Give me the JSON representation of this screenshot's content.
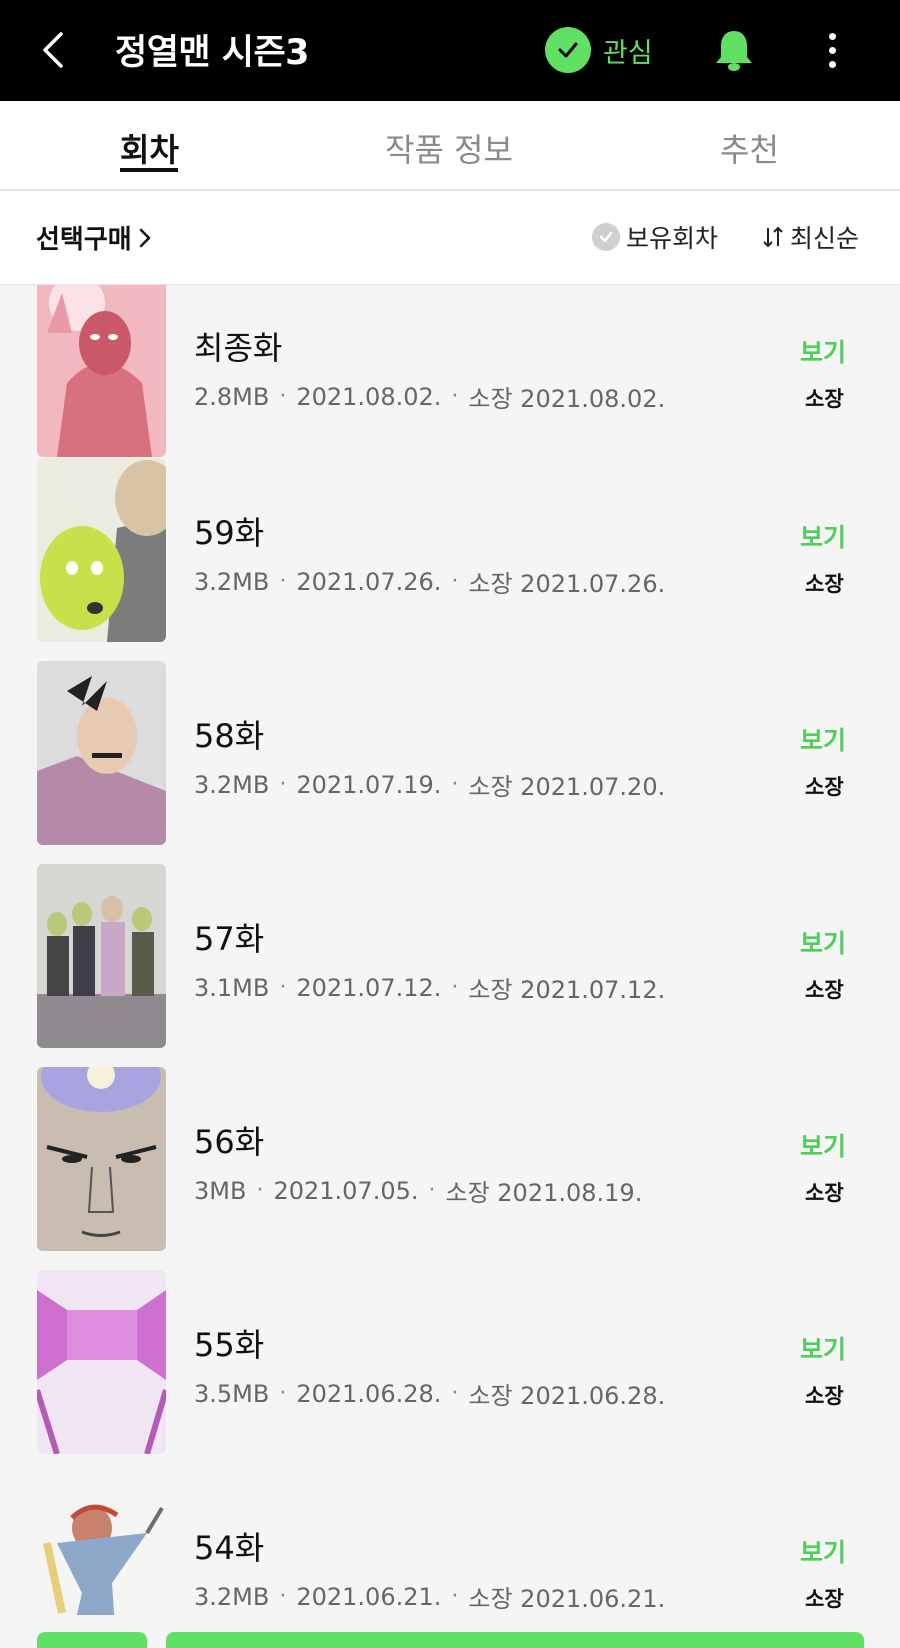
{
  "header": {
    "title": "정열맨 시즌3",
    "favorite_label": "관심",
    "icons": [
      "back-icon",
      "check-icon",
      "bell-icon",
      "more-vertical-icon"
    ],
    "accent_color": "#5fe063"
  },
  "tabs": [
    {
      "label": "회차",
      "active": true
    },
    {
      "label": "작품 정보",
      "active": false
    },
    {
      "label": "추천",
      "active": false
    }
  ],
  "filter": {
    "select_buy": "선택구매",
    "owned_label": "보유회차",
    "sort_label": "최신순"
  },
  "episodes": [
    {
      "title": "최종화",
      "size": "2.8MB",
      "date": "2021.08.02.",
      "owned": "소장 2021.08.02.",
      "view": "보기",
      "badge": "소장"
    },
    {
      "title": "59화",
      "size": "3.2MB",
      "date": "2021.07.26.",
      "owned": "소장 2021.07.26.",
      "view": "보기",
      "badge": "소장"
    },
    {
      "title": "58화",
      "size": "3.2MB",
      "date": "2021.07.19.",
      "owned": "소장 2021.07.20.",
      "view": "보기",
      "badge": "소장"
    },
    {
      "title": "57화",
      "size": "3.1MB",
      "date": "2021.07.12.",
      "owned": "소장 2021.07.12.",
      "view": "보기",
      "badge": "소장"
    },
    {
      "title": "56화",
      "size": "3MB",
      "date": "2021.07.05.",
      "owned": "소장 2021.08.19.",
      "view": "보기",
      "badge": "소장"
    },
    {
      "title": "55화",
      "size": "3.5MB",
      "date": "2021.06.28.",
      "owned": "소장 2021.06.28.",
      "view": "보기",
      "badge": "소장"
    },
    {
      "title": "54화",
      "size": "3.2MB",
      "date": "2021.06.21.",
      "owned": "소장 2021.06.21.",
      "view": "보기",
      "badge": "소장"
    }
  ]
}
